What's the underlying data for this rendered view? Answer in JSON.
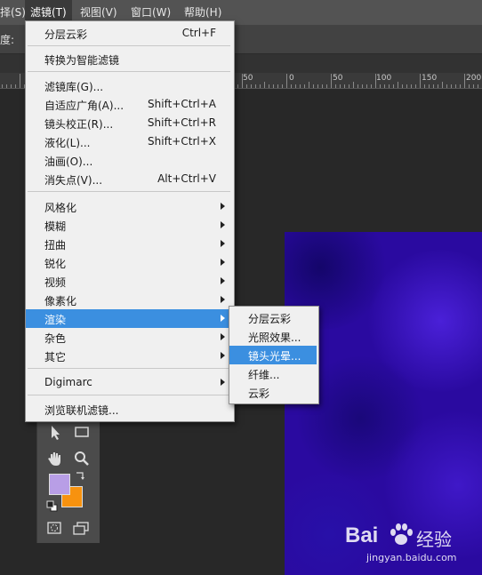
{
  "menubar": {
    "items": [
      "择(S)",
      "滤镜(T)",
      "视图(V)",
      "窗口(W)",
      "帮助(H)"
    ],
    "active_index": 1
  },
  "options_bar": {
    "label": "度:"
  },
  "ruler": {
    "labels": [
      "50",
      "0",
      "50",
      "100",
      "150",
      "200"
    ]
  },
  "filter_menu": {
    "items": [
      {
        "label": "分层云彩",
        "shortcut": "Ctrl+F"
      },
      {
        "label": "转换为智能滤镜"
      },
      {
        "label": "滤镜库(G)..."
      },
      {
        "label": "自适应广角(A)...",
        "shortcut": "Shift+Ctrl+A"
      },
      {
        "label": "镜头校正(R)...",
        "shortcut": "Shift+Ctrl+R"
      },
      {
        "label": "液化(L)...",
        "shortcut": "Shift+Ctrl+X"
      },
      {
        "label": "油画(O)..."
      },
      {
        "label": "消失点(V)...",
        "shortcut": "Alt+Ctrl+V"
      },
      {
        "label": "风格化",
        "submenu": true
      },
      {
        "label": "模糊",
        "submenu": true
      },
      {
        "label": "扭曲",
        "submenu": true
      },
      {
        "label": "锐化",
        "submenu": true
      },
      {
        "label": "视频",
        "submenu": true
      },
      {
        "label": "像素化",
        "submenu": true
      },
      {
        "label": "渲染",
        "submenu": true,
        "highlighted": true
      },
      {
        "label": "杂色",
        "submenu": true
      },
      {
        "label": "其它",
        "submenu": true
      },
      {
        "label": "Digimarc",
        "submenu": true
      },
      {
        "label": "浏览联机滤镜..."
      }
    ]
  },
  "render_submenu": {
    "items": [
      {
        "label": "分层云彩"
      },
      {
        "label": "光照效果..."
      },
      {
        "label": "镜头光晕...",
        "highlighted": true
      },
      {
        "label": "纤维..."
      },
      {
        "label": "云彩"
      }
    ]
  },
  "toolbar": {
    "tools": [
      "move-arrow-icon",
      "rectangle-icon",
      "hand-icon",
      "zoom-icon",
      "swap-colors-icon",
      "default-colors-icon",
      "quick-mask-icon",
      "screen-mode-icon"
    ],
    "foreground_color": "#b89ee6",
    "background_color": "#f7920f"
  },
  "canvas": {
    "color": "#2a0aa0"
  },
  "watermark": {
    "brand": "Bai",
    "brand_suffix": "经验",
    "url": "jingyan.baidu.com"
  },
  "colors": {
    "menu_highlight": "#3b8fe0",
    "menu_bg": "#f0f0f0"
  }
}
